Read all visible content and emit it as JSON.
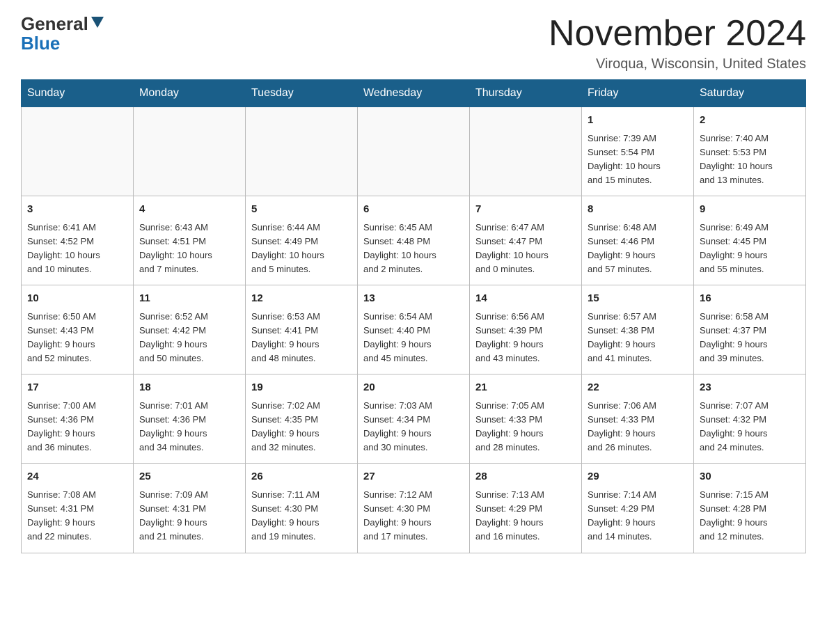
{
  "logo": {
    "general": "General",
    "blue": "Blue"
  },
  "title": "November 2024",
  "location": "Viroqua, Wisconsin, United States",
  "weekdays": [
    "Sunday",
    "Monday",
    "Tuesday",
    "Wednesday",
    "Thursday",
    "Friday",
    "Saturday"
  ],
  "weeks": [
    [
      {
        "day": "",
        "info": ""
      },
      {
        "day": "",
        "info": ""
      },
      {
        "day": "",
        "info": ""
      },
      {
        "day": "",
        "info": ""
      },
      {
        "day": "",
        "info": ""
      },
      {
        "day": "1",
        "info": "Sunrise: 7:39 AM\nSunset: 5:54 PM\nDaylight: 10 hours\nand 15 minutes."
      },
      {
        "day": "2",
        "info": "Sunrise: 7:40 AM\nSunset: 5:53 PM\nDaylight: 10 hours\nand 13 minutes."
      }
    ],
    [
      {
        "day": "3",
        "info": "Sunrise: 6:41 AM\nSunset: 4:52 PM\nDaylight: 10 hours\nand 10 minutes."
      },
      {
        "day": "4",
        "info": "Sunrise: 6:43 AM\nSunset: 4:51 PM\nDaylight: 10 hours\nand 7 minutes."
      },
      {
        "day": "5",
        "info": "Sunrise: 6:44 AM\nSunset: 4:49 PM\nDaylight: 10 hours\nand 5 minutes."
      },
      {
        "day": "6",
        "info": "Sunrise: 6:45 AM\nSunset: 4:48 PM\nDaylight: 10 hours\nand 2 minutes."
      },
      {
        "day": "7",
        "info": "Sunrise: 6:47 AM\nSunset: 4:47 PM\nDaylight: 10 hours\nand 0 minutes."
      },
      {
        "day": "8",
        "info": "Sunrise: 6:48 AM\nSunset: 4:46 PM\nDaylight: 9 hours\nand 57 minutes."
      },
      {
        "day": "9",
        "info": "Sunrise: 6:49 AM\nSunset: 4:45 PM\nDaylight: 9 hours\nand 55 minutes."
      }
    ],
    [
      {
        "day": "10",
        "info": "Sunrise: 6:50 AM\nSunset: 4:43 PM\nDaylight: 9 hours\nand 52 minutes."
      },
      {
        "day": "11",
        "info": "Sunrise: 6:52 AM\nSunset: 4:42 PM\nDaylight: 9 hours\nand 50 minutes."
      },
      {
        "day": "12",
        "info": "Sunrise: 6:53 AM\nSunset: 4:41 PM\nDaylight: 9 hours\nand 48 minutes."
      },
      {
        "day": "13",
        "info": "Sunrise: 6:54 AM\nSunset: 4:40 PM\nDaylight: 9 hours\nand 45 minutes."
      },
      {
        "day": "14",
        "info": "Sunrise: 6:56 AM\nSunset: 4:39 PM\nDaylight: 9 hours\nand 43 minutes."
      },
      {
        "day": "15",
        "info": "Sunrise: 6:57 AM\nSunset: 4:38 PM\nDaylight: 9 hours\nand 41 minutes."
      },
      {
        "day": "16",
        "info": "Sunrise: 6:58 AM\nSunset: 4:37 PM\nDaylight: 9 hours\nand 39 minutes."
      }
    ],
    [
      {
        "day": "17",
        "info": "Sunrise: 7:00 AM\nSunset: 4:36 PM\nDaylight: 9 hours\nand 36 minutes."
      },
      {
        "day": "18",
        "info": "Sunrise: 7:01 AM\nSunset: 4:36 PM\nDaylight: 9 hours\nand 34 minutes."
      },
      {
        "day": "19",
        "info": "Sunrise: 7:02 AM\nSunset: 4:35 PM\nDaylight: 9 hours\nand 32 minutes."
      },
      {
        "day": "20",
        "info": "Sunrise: 7:03 AM\nSunset: 4:34 PM\nDaylight: 9 hours\nand 30 minutes."
      },
      {
        "day": "21",
        "info": "Sunrise: 7:05 AM\nSunset: 4:33 PM\nDaylight: 9 hours\nand 28 minutes."
      },
      {
        "day": "22",
        "info": "Sunrise: 7:06 AM\nSunset: 4:33 PM\nDaylight: 9 hours\nand 26 minutes."
      },
      {
        "day": "23",
        "info": "Sunrise: 7:07 AM\nSunset: 4:32 PM\nDaylight: 9 hours\nand 24 minutes."
      }
    ],
    [
      {
        "day": "24",
        "info": "Sunrise: 7:08 AM\nSunset: 4:31 PM\nDaylight: 9 hours\nand 22 minutes."
      },
      {
        "day": "25",
        "info": "Sunrise: 7:09 AM\nSunset: 4:31 PM\nDaylight: 9 hours\nand 21 minutes."
      },
      {
        "day": "26",
        "info": "Sunrise: 7:11 AM\nSunset: 4:30 PM\nDaylight: 9 hours\nand 19 minutes."
      },
      {
        "day": "27",
        "info": "Sunrise: 7:12 AM\nSunset: 4:30 PM\nDaylight: 9 hours\nand 17 minutes."
      },
      {
        "day": "28",
        "info": "Sunrise: 7:13 AM\nSunset: 4:29 PM\nDaylight: 9 hours\nand 16 minutes."
      },
      {
        "day": "29",
        "info": "Sunrise: 7:14 AM\nSunset: 4:29 PM\nDaylight: 9 hours\nand 14 minutes."
      },
      {
        "day": "30",
        "info": "Sunrise: 7:15 AM\nSunset: 4:28 PM\nDaylight: 9 hours\nand 12 minutes."
      }
    ]
  ]
}
